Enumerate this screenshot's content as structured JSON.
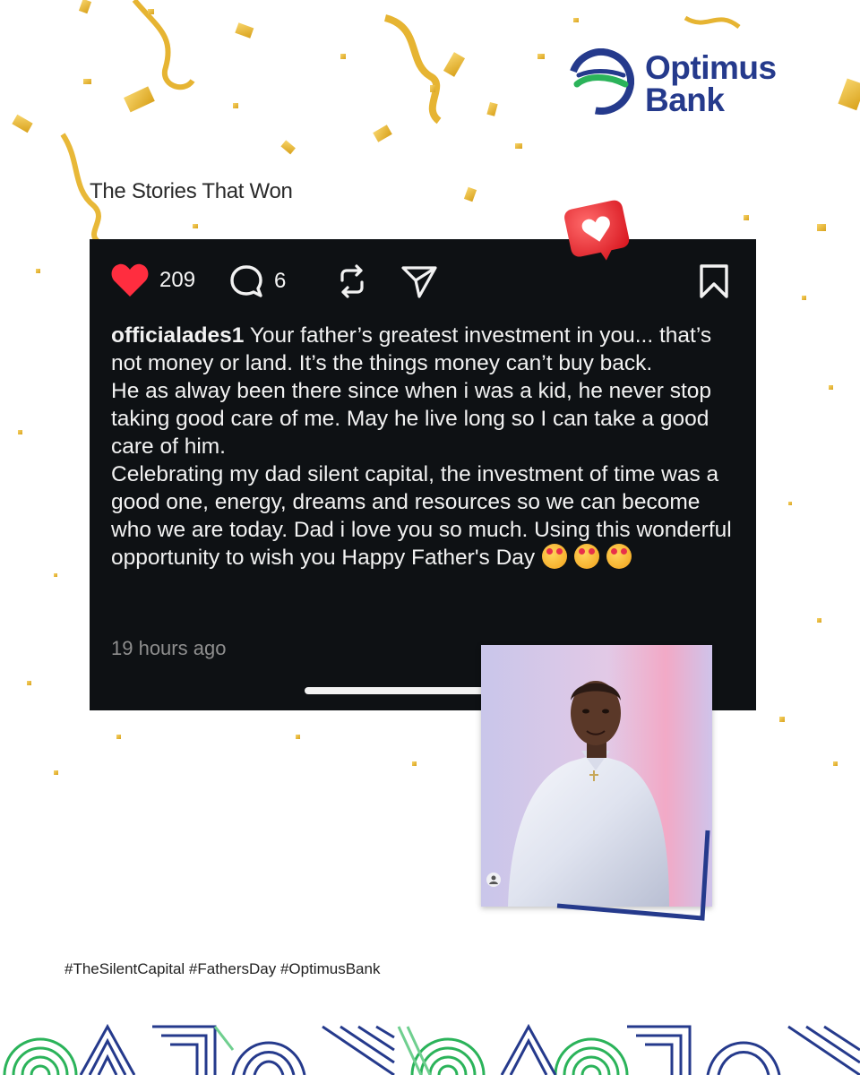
{
  "brand": {
    "name_line1": "Optimus",
    "name_line2": "Bank",
    "color_primary": "#253a8c",
    "color_green": "#2bb35a"
  },
  "section_title": "The Stories That Won",
  "post": {
    "likes": "209",
    "comments": "6",
    "icons": [
      "heart-icon",
      "comment-icon",
      "repost-icon",
      "share-icon",
      "bookmark-icon"
    ],
    "username": "officialades1",
    "caption_first": "Your father’s greatest investment in you... that’s not money or land. It’s the things money can’t buy back.",
    "caption_second": "He as alway been there since when i was a kid, he never stop taking good care of me. May he live long so I can take a good care of him.",
    "caption_third": "Celebrating my dad silent capital, the investment of time was a good one, energy, dreams and resources so  we can become who we are today. Dad i love you so much. Using this wonderful opportunity to wish you Happy Father's Day",
    "emojis": [
      "smiling-face-with-hearts",
      "smiling-face-with-hearts",
      "smiling-face-with-hearts"
    ],
    "time": "19 hours ago"
  },
  "hashtags": "#TheSilentCapital #FathersDay #OptimusBank"
}
